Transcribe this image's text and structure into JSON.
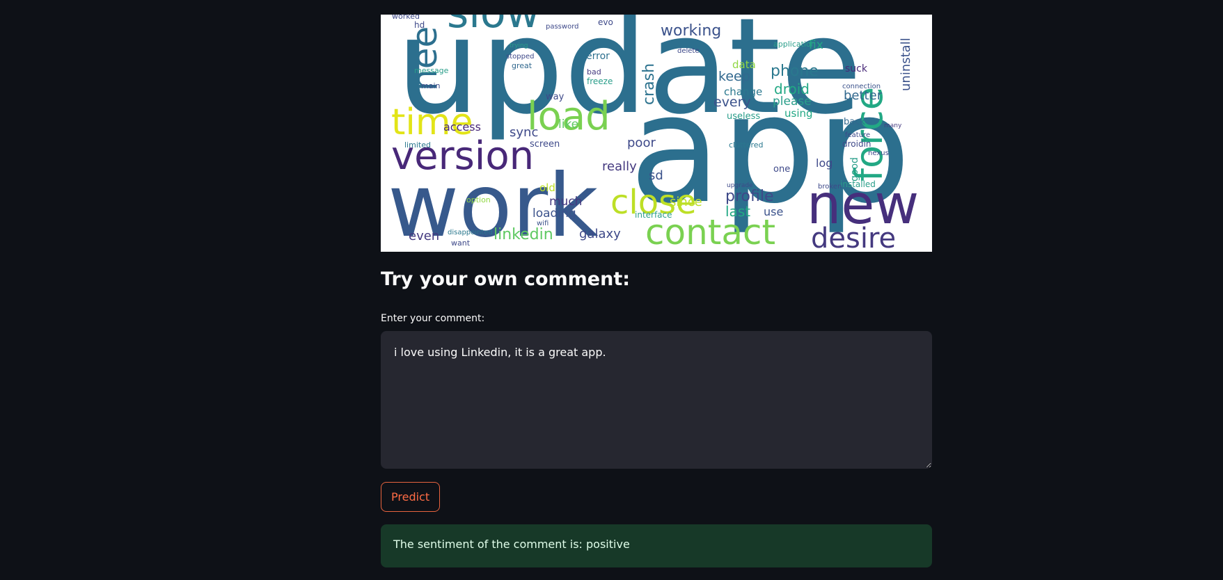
{
  "wordcloud": {
    "words": [
      {
        "text": "update",
        "color": "#2c6f8e"
      },
      {
        "text": "app",
        "color": "#2c6f8e"
      },
      {
        "text": "work",
        "color": "#37598c"
      },
      {
        "text": "version",
        "color": "#482878"
      },
      {
        "text": "load",
        "color": "#7ad151"
      },
      {
        "text": "time",
        "color": "#e2e418"
      },
      {
        "text": "new",
        "color": "#462f7c"
      },
      {
        "text": "force",
        "color": "#22a884"
      },
      {
        "text": "close",
        "color": "#bddf26"
      },
      {
        "text": "contact",
        "color": "#7ad151"
      },
      {
        "text": "desire",
        "color": "#44397f"
      },
      {
        "text": "slow",
        "color": "#2a788e"
      },
      {
        "text": "nee",
        "color": "#2c6f8e"
      },
      {
        "text": "crash",
        "color": "#2c728e"
      },
      {
        "text": "working",
        "color": "#3b528b"
      },
      {
        "text": "phone",
        "color": "#2a788e"
      },
      {
        "text": "droid",
        "color": "#22a884"
      },
      {
        "text": "please",
        "color": "#2a9e8a"
      },
      {
        "text": "keep",
        "color": "#31688e"
      },
      {
        "text": "every",
        "color": "#3b528b"
      },
      {
        "text": "better",
        "color": "#31688e"
      },
      {
        "text": "uninstall",
        "color": "#3b528b"
      },
      {
        "text": "fix",
        "color": "#22a884"
      },
      {
        "text": "data",
        "color": "#90d743"
      },
      {
        "text": "change",
        "color": "#2a788e"
      },
      {
        "text": "useless",
        "color": "#2a9e8a"
      },
      {
        "text": "using",
        "color": "#22a884"
      },
      {
        "text": "suck",
        "color": "#482878"
      },
      {
        "text": "sync",
        "color": "#3e4989"
      },
      {
        "text": "like",
        "color": "#5ec962"
      },
      {
        "text": "access",
        "color": "#482878"
      },
      {
        "text": "poor",
        "color": "#3e4989"
      },
      {
        "text": "really",
        "color": "#44397f"
      },
      {
        "text": "sd",
        "color": "#3b528b"
      },
      {
        "text": "since",
        "color": "#bddf26"
      },
      {
        "text": "profile",
        "color": "#3e4989"
      },
      {
        "text": "last",
        "color": "#22a884"
      },
      {
        "text": "use",
        "color": "#3b528b"
      },
      {
        "text": "log",
        "color": "#3e4989"
      },
      {
        "text": "good",
        "color": "#2a9e8a"
      },
      {
        "text": "much",
        "color": "#44397f"
      },
      {
        "text": "loading",
        "color": "#3b528b"
      },
      {
        "text": "old",
        "color": "#bddf26"
      },
      {
        "text": "even",
        "color": "#44397f"
      },
      {
        "text": "linkedin",
        "color": "#5ec962"
      },
      {
        "text": "galaxy",
        "color": "#3e4989"
      },
      {
        "text": "back",
        "color": "#31688e"
      },
      {
        "text": "error",
        "color": "#2c6f8e"
      },
      {
        "text": "freeze",
        "color": "#2a9e8a"
      },
      {
        "text": "screen",
        "color": "#3e4989"
      },
      {
        "text": "way",
        "color": "#3e4989"
      },
      {
        "text": "message",
        "color": "#2a9e8a"
      },
      {
        "text": "main",
        "color": "#3e4989"
      },
      {
        "text": "limited",
        "color": "#2a788e"
      },
      {
        "text": "great",
        "color": "#31688e"
      },
      {
        "text": "hd",
        "color": "#3e4989"
      },
      {
        "text": "worked",
        "color": "#3e4989"
      },
      {
        "text": "evo",
        "color": "#3e4989"
      },
      {
        "text": "bad",
        "color": "#44397f"
      },
      {
        "text": "droidin",
        "color": "#3e4989"
      },
      {
        "text": "installed",
        "color": "#2a9e8a"
      },
      {
        "text": "feature",
        "color": "#3e4989"
      },
      {
        "text": "connection",
        "color": "#3b528b"
      },
      {
        "text": "application",
        "color": "#2a9e8a"
      },
      {
        "text": "one",
        "color": "#3e4989"
      },
      {
        "text": "interface",
        "color": "#2a9e8a"
      },
      {
        "text": "wifi",
        "color": "#3b528b"
      },
      {
        "text": "want",
        "color": "#3e4989"
      },
      {
        "text": "disappointed",
        "color": "#2a788e"
      },
      {
        "text": "option",
        "color": "#90d743"
      },
      {
        "text": "stopped",
        "color": "#3e4989"
      },
      {
        "text": "trying",
        "color": "#2a9e8a"
      },
      {
        "text": "password",
        "color": "#3e4989"
      },
      {
        "text": "delete",
        "color": "#3e4989"
      },
      {
        "text": "cluttered",
        "color": "#2a788e"
      },
      {
        "text": "broken",
        "color": "#3e4989"
      },
      {
        "text": "upgrade",
        "color": "#3e4989"
      },
      {
        "text": "many",
        "color": "#44397f"
      },
      {
        "text": "nexus",
        "color": "#3e4989"
      }
    ]
  },
  "section": {
    "title": "Try your own comment:"
  },
  "comment": {
    "label": "Enter your comment:",
    "value": "i love using Linkedin, it is a great app."
  },
  "predict": {
    "label": "Predict"
  },
  "result": {
    "text": "The sentiment of the comment is: positive"
  },
  "colors": {
    "background": "#0e1117",
    "input_bg": "#262730",
    "button_border": "#e8633e",
    "button_text": "#ff6c45",
    "success_bg": "#173928",
    "success_text": "#dffde9"
  }
}
